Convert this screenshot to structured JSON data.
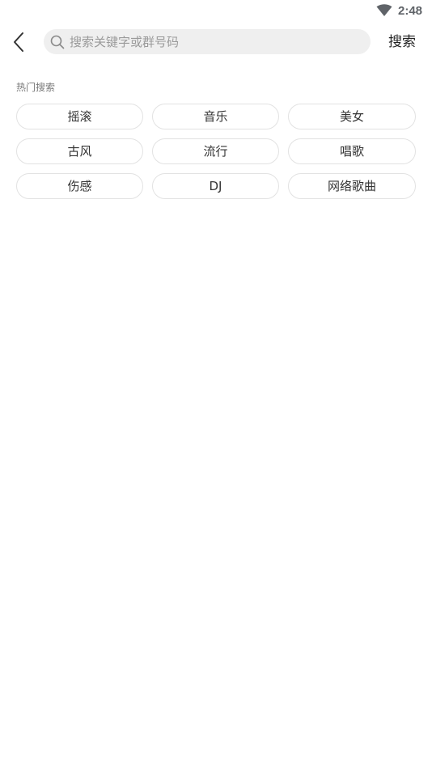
{
  "status_bar": {
    "time": "2:48",
    "wifi_icon": "wifi-icon"
  },
  "header": {
    "back_icon": "chevron-left-icon",
    "search": {
      "icon": "search-icon",
      "placeholder": "搜索关键字或群号码",
      "value": ""
    },
    "search_button_label": "搜索"
  },
  "hot_search": {
    "title": "热门搜索",
    "tags": [
      "摇滚",
      "音乐",
      "美女",
      "古风",
      "流行",
      "唱歌",
      "伤感",
      "DJ",
      "网络歌曲"
    ]
  },
  "colors": {
    "search_bg": "#efefef",
    "tag_border": "#e2e2e2",
    "text_primary": "#333333",
    "text_secondary": "#7a7a7a"
  }
}
